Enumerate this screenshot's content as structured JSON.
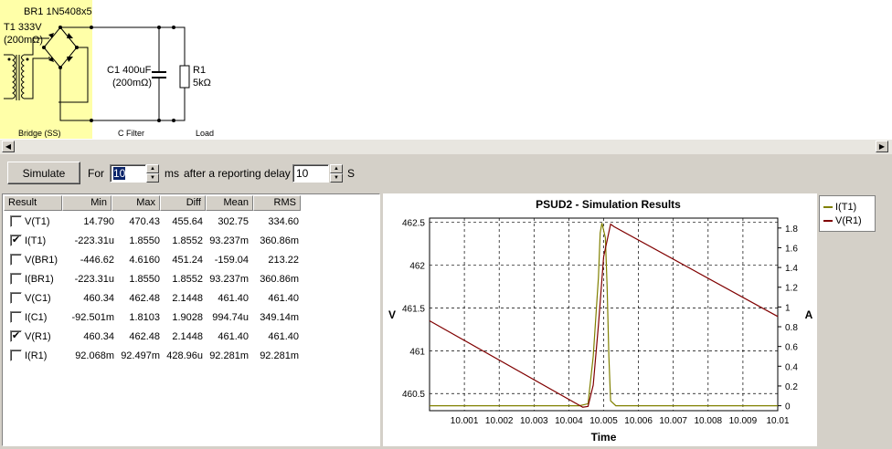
{
  "schematic": {
    "bridge_label": "BR1 1N5408x5",
    "transformer_label": "T1 333V",
    "transformer_res": "(200mΩ)",
    "cap_label": "C1 400uF",
    "cap_res": "(200mΩ)",
    "res_label": "R1",
    "res_value": "5kΩ",
    "section_bridge": "Bridge (SS)",
    "section_filter": "C Filter",
    "section_load": "Load"
  },
  "controls": {
    "simulate_label": "Simulate",
    "for_label": "For",
    "duration_value": "10",
    "ms_label": "ms",
    "delay_label": "after a reporting delay of",
    "delay_value": "10",
    "s_label": "S"
  },
  "table": {
    "headers": [
      "Result",
      "Min",
      "Max",
      "Diff",
      "Mean",
      "RMS"
    ],
    "rows": [
      {
        "name": "V(T1)",
        "checked": false,
        "min": "14.790",
        "max": "470.43",
        "diff": "455.64",
        "mean": "302.75",
        "rms": "334.60"
      },
      {
        "name": "I(T1)",
        "checked": true,
        "min": "-223.31u",
        "max": "1.8550",
        "diff": "1.8552",
        "mean": "93.237m",
        "rms": "360.86m"
      },
      {
        "name": "V(BR1)",
        "checked": false,
        "min": "-446.62",
        "max": "4.6160",
        "diff": "451.24",
        "mean": "-159.04",
        "rms": "213.22"
      },
      {
        "name": "I(BR1)",
        "checked": false,
        "min": "-223.31u",
        "max": "1.8550",
        "diff": "1.8552",
        "mean": "93.237m",
        "rms": "360.86m"
      },
      {
        "name": "V(C1)",
        "checked": false,
        "min": "460.34",
        "max": "462.48",
        "diff": "2.1448",
        "mean": "461.40",
        "rms": "461.40"
      },
      {
        "name": "I(C1)",
        "checked": false,
        "min": "-92.501m",
        "max": "1.8103",
        "diff": "1.9028",
        "mean": "994.74u",
        "rms": "349.14m"
      },
      {
        "name": "V(R1)",
        "checked": true,
        "min": "460.34",
        "max": "462.48",
        "diff": "2.1448",
        "mean": "461.40",
        "rms": "461.40"
      },
      {
        "name": "I(R1)",
        "checked": false,
        "min": "92.068m",
        "max": "92.497m",
        "diff": "428.96u",
        "mean": "92.281m",
        "rms": "92.281m"
      }
    ]
  },
  "chart_data": {
    "type": "line",
    "title": "PSUD2 - Simulation Results",
    "xlabel": "Time",
    "ylabel_left": "V",
    "ylabel_right": "A",
    "xlim": [
      10.0,
      10.01
    ],
    "ylim_left": [
      460.3,
      462.55
    ],
    "ylim_right": [
      -0.05,
      1.9
    ],
    "x_ticks": [
      "10.001",
      "10.002",
      "10.003",
      "10.004",
      "10.005",
      "10.006",
      "10.007",
      "10.008",
      "10.009",
      "10.01"
    ],
    "y_left_ticks": [
      "462.5",
      "462",
      "461.5",
      "461",
      "460.5"
    ],
    "y_right_ticks": [
      "1.8",
      "1.6",
      "1.4",
      "1.2",
      "1",
      "0.8",
      "0.6",
      "0.4",
      "0.2",
      "0"
    ],
    "grid": true,
    "legend_position": "right",
    "series": [
      {
        "name": "I(T1)",
        "axis": "right",
        "color": "#808000",
        "x": [
          10.0,
          10.0043,
          10.00455,
          10.0047,
          10.00485,
          10.0049,
          10.00495,
          10.00505,
          10.0051,
          10.00515,
          10.0052,
          10.00535,
          10.01
        ],
        "y": [
          0,
          0,
          0.02,
          0.5,
          1.3,
          1.75,
          1.85,
          1.7,
          1.2,
          0.5,
          0.05,
          0,
          0
        ]
      },
      {
        "name": "V(R1)",
        "axis": "left",
        "color": "#800000",
        "x": [
          10.0,
          10.0044,
          10.00455,
          10.0047,
          10.00485,
          10.005,
          10.0052,
          10.0053,
          10.01
        ],
        "y": [
          461.35,
          460.34,
          460.35,
          460.6,
          461.3,
          462.1,
          462.48,
          462.45,
          461.4
        ]
      }
    ]
  },
  "colors": {
    "schematic_highlight": "#ffffa8",
    "window_bg": "#d4d0c8"
  }
}
